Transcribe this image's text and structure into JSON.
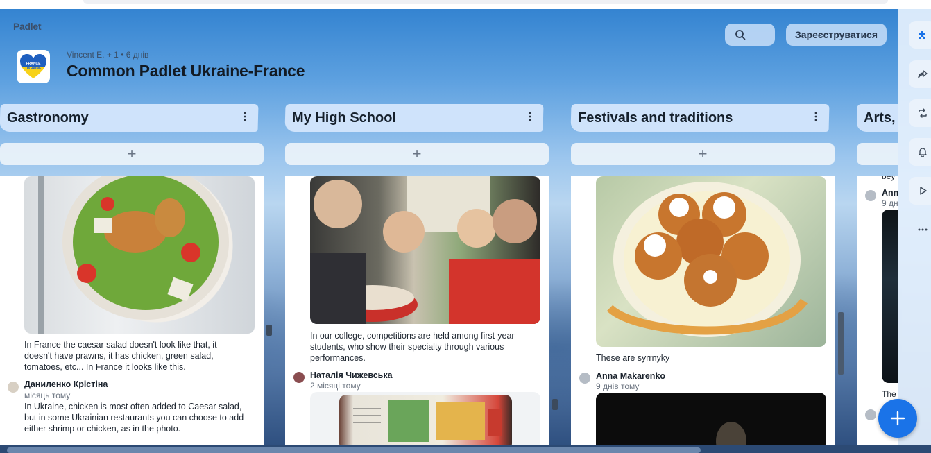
{
  "app": {
    "logo": "Padlet"
  },
  "board": {
    "meta": "Vincent E. + 1 • 6 днів",
    "title": "Common Padlet Ukraine-France",
    "icon_text_top": "FRANCE",
    "icon_text_bottom": "UKRAINE"
  },
  "header": {
    "search_icon": "search-icon",
    "register_label": "Зареєструватися"
  },
  "columns": [
    {
      "title": "Gastronomy",
      "post1": {
        "caption": "In France the caesar salad doesn't look like that, it doesn't have prawns, it has chicken, green salad, tomatoes, etc... In France it looks like this.",
        "author": "Даниленко Крістіна",
        "time": "місяць тому",
        "comment": "In Ukraine, chicken is most often added to Caesar salad, but in some Ukrainian restaurants you can choose to add either shrimp or chicken, as in the photo."
      }
    },
    {
      "title": "My High School",
      "post1": {
        "caption": "In our college, competitions are held among first-year students, who show their specialty through various performances.",
        "author": "Наталія Чижевська",
        "time": "2 місяці тому"
      }
    },
    {
      "title": "Festivals and traditions",
      "post1": {
        "caption": "These are syrrnyky",
        "author": "Anna Makarenko",
        "time": "9 днів тому"
      }
    },
    {
      "title": "Arts,",
      "partial": {
        "line1": "bey",
        "author": "Ann",
        "time": "9 дн",
        "bottom": "The"
      }
    }
  ],
  "rail": [
    "puzzle-icon",
    "share-icon",
    "remix-icon",
    "bell-icon",
    "play-icon",
    "more-icon"
  ],
  "colors": {
    "accent": "#1a73e8",
    "header_blue": "#cfe3fb"
  }
}
